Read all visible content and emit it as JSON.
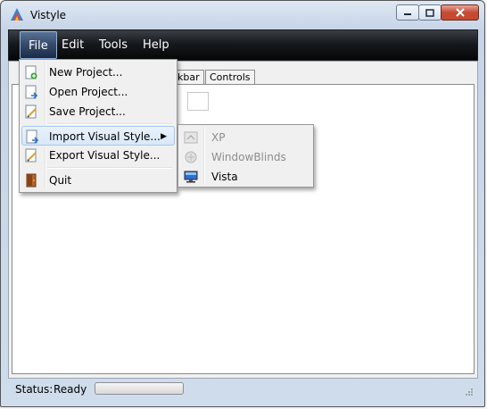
{
  "window": {
    "title": "Vistyle",
    "app_icon": "vistyle-app-icon"
  },
  "titlebar_buttons": {
    "minimize_icon": "minimize-icon",
    "maximize_icon": "maximize-icon",
    "close_icon": "close-icon"
  },
  "menubar": {
    "items": [
      "File",
      "Edit",
      "Tools",
      "Help"
    ],
    "active": "File"
  },
  "tabs": {
    "visible_labels": [
      "kbar",
      "Controls"
    ]
  },
  "file_menu": {
    "items": [
      {
        "label": "New Project...",
        "icon": "new-project-icon"
      },
      {
        "label": "Open Project...",
        "icon": "open-project-icon"
      },
      {
        "label": "Save Project...",
        "icon": "save-project-icon"
      },
      {
        "label": "Import Visual Style...",
        "icon": "import-style-icon",
        "has_submenu": true,
        "highlighted": true
      },
      {
        "label": "Export Visual Style...",
        "icon": "export-style-icon"
      },
      {
        "label": "Quit",
        "icon": "quit-door-icon"
      }
    ]
  },
  "import_submenu": {
    "items": [
      {
        "label": "XP",
        "icon": "xp-icon",
        "enabled": false
      },
      {
        "label": "WindowBlinds",
        "icon": "windowblinds-icon",
        "enabled": false
      },
      {
        "label": "Vista",
        "icon": "vista-monitor-icon",
        "enabled": true
      }
    ]
  },
  "status": {
    "label": "Status:",
    "value": "Ready"
  },
  "colors": {
    "menubar": "#0b0d10",
    "highlight_border": "#a8c8ec",
    "disabled_text": "#8d8d8d"
  }
}
